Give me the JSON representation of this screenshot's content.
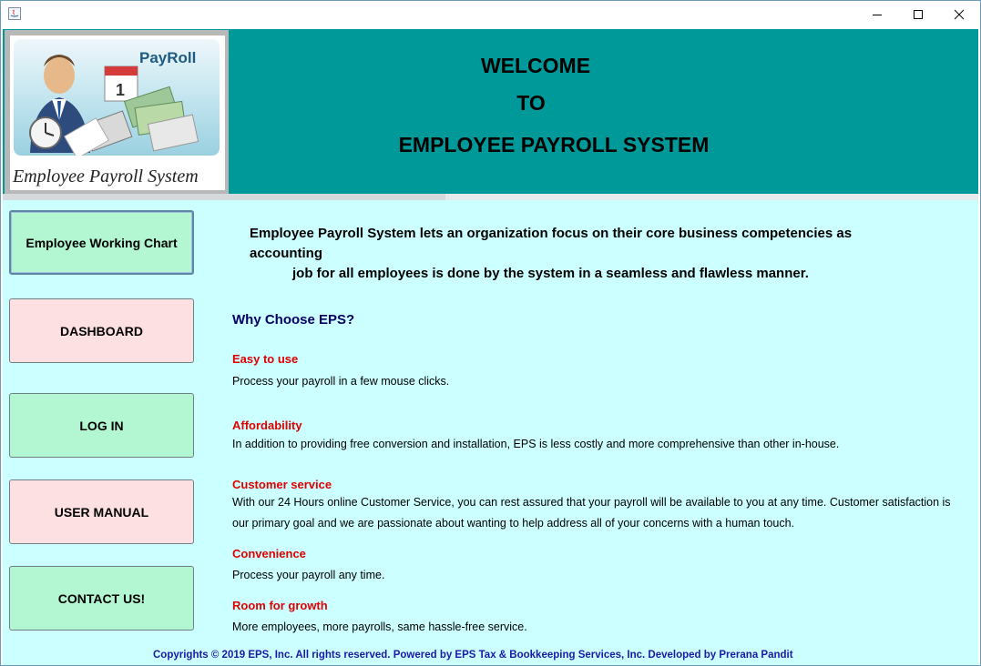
{
  "window": {
    "controls": {
      "minimize": "minimize",
      "maximize": "maximize",
      "close": "close"
    }
  },
  "header": {
    "logo_brand": "PayRoll",
    "logo_caption": "Employee Payroll System",
    "welcome_line1": "WELCOME",
    "welcome_line2": "TO",
    "welcome_line3": "EMPLOYEE PAYROLL SYSTEM",
    "background": "#009999"
  },
  "nav": {
    "working_chart": "Employee Working Chart",
    "dashboard": "DASHBOARD",
    "login": "LOG IN",
    "user_manual": "USER MANUAL",
    "contact": "CONTACT US!"
  },
  "content": {
    "intro_line1": "Employee Payroll System lets an organization focus on their core business competencies as accounting",
    "intro_line2": "job for all employees is done by the system in a seamless and flawless manner.",
    "why_title": "Why Choose EPS?",
    "sections": [
      {
        "title": "Easy to use",
        "text": [
          "Process your payroll in a few mouse clicks."
        ]
      },
      {
        "title": "Affordability",
        "text": [
          "In addition to providing free conversion and installation, EPS is less costly and more comprehensive than other in-house."
        ]
      },
      {
        "title": "Customer service",
        "text": [
          "With our 24 Hours online Customer Service, you can rest assured that your payroll will be available to you at any time. Customer satisfaction is",
          "our primary goal and we are passionate about wanting to help address all of your concerns with a human touch."
        ]
      },
      {
        "title": "Convenience",
        "text": [
          "Process your payroll any time."
        ]
      },
      {
        "title": "Room for growth",
        "text": [
          "More employees, more payrolls, same hassle-free service."
        ]
      }
    ],
    "footer": "Copyrights © 2019  EPS, Inc. All rights reserved. Powered by EPS Tax & Bookkeeping Services, Inc. Developed by Prerana Pandit"
  },
  "colors": {
    "main_bg": "#ccffff",
    "btn_green": "#b3f6d2",
    "btn_pink": "#fde0e2",
    "section_title": "#e00000",
    "why_title": "#000066",
    "footer": "#1a1aa8"
  },
  "icons": [
    "java-app-icon",
    "minimize-icon",
    "maximize-icon",
    "close-icon",
    "payroll-logo-illustration"
  ]
}
